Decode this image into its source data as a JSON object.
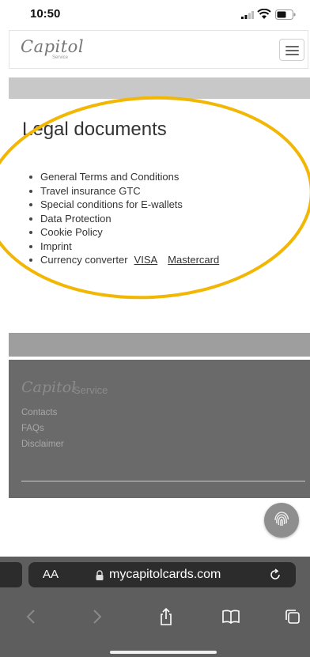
{
  "status_bar": {
    "time": "10:50"
  },
  "header": {
    "logo": "Capitol",
    "logo_sub": "Service"
  },
  "legal": {
    "heading": "Legal documents",
    "items": [
      "General Terms and Conditions",
      "Travel insurance GTC",
      "Special conditions for E-wallets",
      "Data Protection",
      "Cookie Policy",
      "Imprint"
    ],
    "currency_label": "Currency converter",
    "currency_links": [
      "VISA",
      "Mastercard"
    ]
  },
  "footer": {
    "logo": "Capitol",
    "service": "Service",
    "links": [
      "Contacts",
      "FAQs",
      "Disclaimer"
    ]
  },
  "browser": {
    "aa_label": "AA",
    "url": "mycapitolcards.com"
  },
  "colors": {
    "highlight": "#f2b705",
    "footer_bg": "#6a6a6a"
  },
  "icons": [
    "signal-icon",
    "wifi-icon",
    "battery-icon",
    "menu-icon",
    "fingerprint-icon",
    "lock-icon",
    "reload-icon",
    "back-icon",
    "forward-icon",
    "share-icon",
    "bookmarks-icon",
    "tabs-icon"
  ]
}
